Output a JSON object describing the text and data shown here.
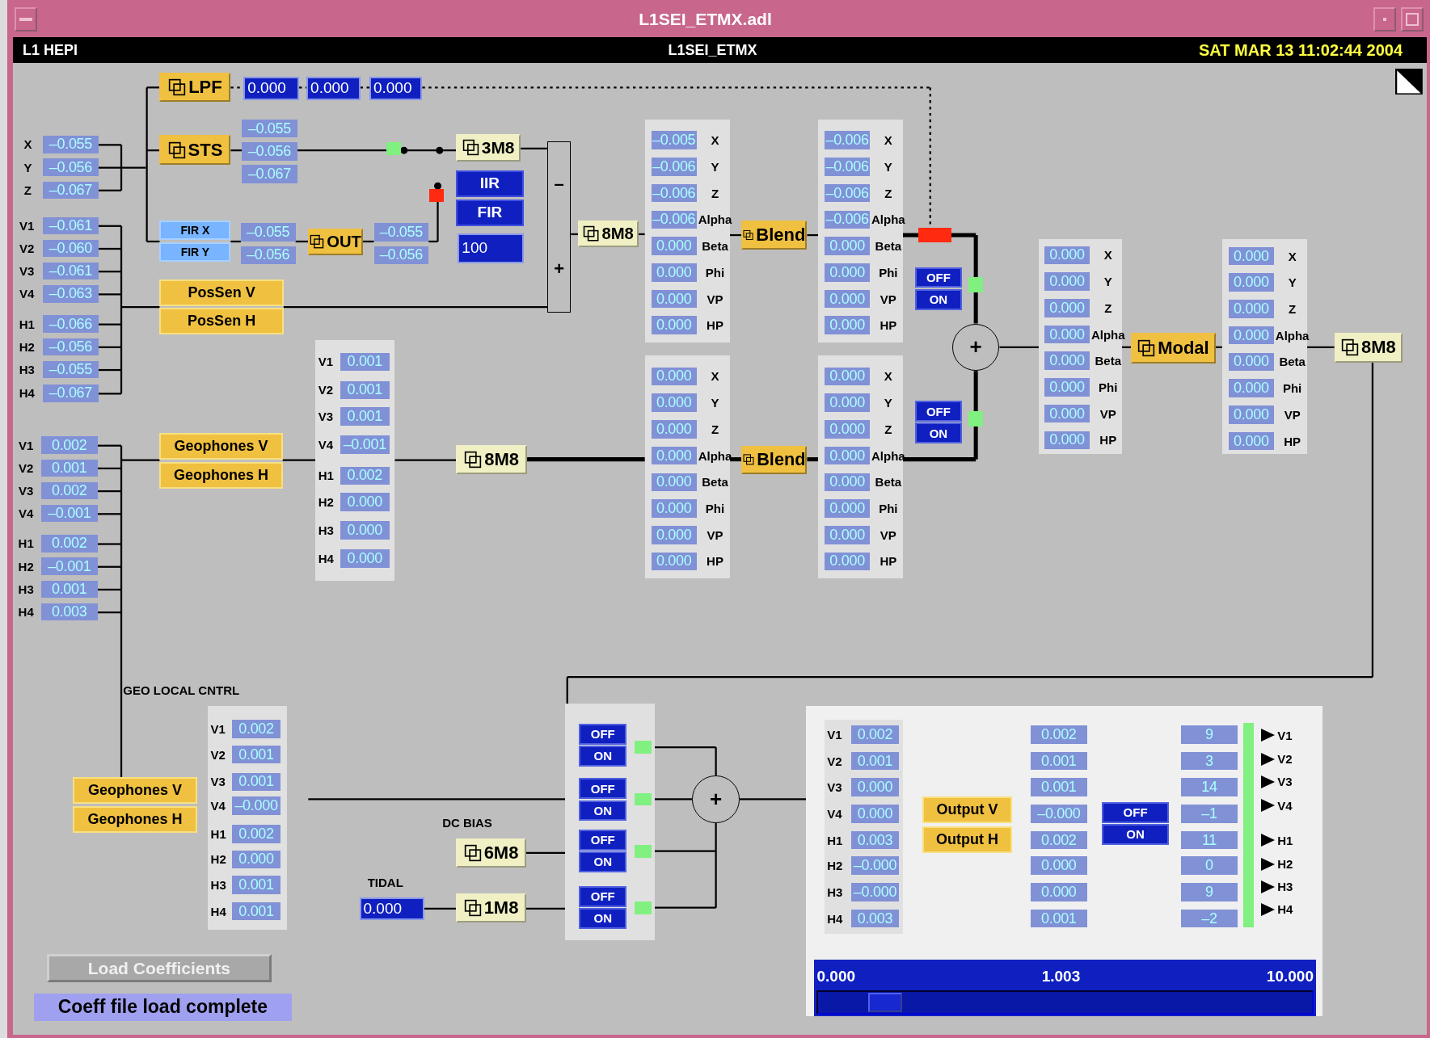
{
  "window": {
    "title": "L1SEI_ETMX.adl"
  },
  "header": {
    "system": "L1 HEPI",
    "screen": "L1SEI_ETMX",
    "timestamp": "SAT MAR 13 11:02:44 2004"
  },
  "columns": [
    {
      "rows": [
        {
          "label": "X",
          "value": "–0.055"
        },
        {
          "label": "Y",
          "value": "–0.056"
        },
        {
          "label": "Z",
          "value": "–0.067"
        }
      ]
    },
    {
      "rows": [
        {
          "label": "V1",
          "value": "–0.061"
        },
        {
          "label": "V2",
          "value": "–0.060"
        },
        {
          "label": "V3",
          "value": "–0.061"
        },
        {
          "label": "V4",
          "value": "–0.063"
        },
        {
          "label": "H1",
          "value": "–0.066"
        },
        {
          "label": "H2",
          "value": "–0.056"
        },
        {
          "label": "H3",
          "value": "–0.055"
        },
        {
          "label": "H4",
          "value": "–0.067"
        }
      ]
    },
    {
      "rows": [
        {
          "label": "V1",
          "value": "0.002"
        },
        {
          "label": "V2",
          "value": "0.001"
        },
        {
          "label": "V3",
          "value": "0.002"
        },
        {
          "label": "V4",
          "value": "–0.001"
        },
        {
          "label": "H1",
          "value": "0.002"
        },
        {
          "label": "H2",
          "value": "–0.001"
        },
        {
          "label": "H3",
          "value": "0.001"
        },
        {
          "label": "H4",
          "value": "0.003"
        }
      ]
    },
    {
      "rows": [
        {
          "value": "–0.055"
        },
        {
          "value": "–0.056"
        },
        {
          "value": "–0.067"
        }
      ]
    },
    {
      "rows": [
        {
          "value": "–0.055"
        },
        {
          "value": "–0.056"
        }
      ]
    },
    {
      "rows": [
        {
          "value": "–0.055"
        },
        {
          "value": "–0.056"
        }
      ]
    },
    {
      "rows": [
        {
          "label": "V1",
          "value": "0.001"
        },
        {
          "label": "V2",
          "value": "0.001"
        },
        {
          "label": "V3",
          "value": "0.001"
        },
        {
          "label": "V4",
          "value": "–0.001"
        },
        {
          "label": "H1",
          "value": "0.002"
        },
        {
          "label": "H2",
          "value": "0.000"
        },
        {
          "label": "H3",
          "value": "0.000"
        },
        {
          "label": "H4",
          "value": "0.000"
        }
      ]
    },
    {
      "rows": [
        {
          "label": "X",
          "value": "–0.005"
        },
        {
          "label": "Y",
          "value": "–0.006"
        },
        {
          "label": "Z",
          "value": "–0.006"
        },
        {
          "label": "Alpha",
          "value": "–0.006"
        },
        {
          "label": "Beta",
          "value": "0.000"
        },
        {
          "label": "Phi",
          "value": "0.000"
        },
        {
          "label": "VP",
          "value": "0.000"
        },
        {
          "label": "HP",
          "value": "0.000"
        }
      ]
    },
    {
      "rows": [
        {
          "label": "X",
          "value": "–0.006"
        },
        {
          "label": "Y",
          "value": "–0.006"
        },
        {
          "label": "Z",
          "value": "–0.006"
        },
        {
          "label": "Alpha",
          "value": "–0.006"
        },
        {
          "label": "Beta",
          "value": "0.000"
        },
        {
          "label": "Phi",
          "value": "0.000"
        },
        {
          "label": "VP",
          "value": "0.000"
        },
        {
          "label": "HP",
          "value": "0.000"
        }
      ]
    },
    {
      "rows": [
        {
          "label": "X",
          "value": "0.000"
        },
        {
          "label": "Y",
          "value": "0.000"
        },
        {
          "label": "Z",
          "value": "0.000"
        },
        {
          "label": "Alpha",
          "value": "0.000"
        },
        {
          "label": "Beta",
          "value": "0.000"
        },
        {
          "label": "Phi",
          "value": "0.000"
        },
        {
          "label": "VP",
          "value": "0.000"
        },
        {
          "label": "HP",
          "value": "0.000"
        }
      ]
    },
    {
      "rows": [
        {
          "label": "X",
          "value": "0.000"
        },
        {
          "label": "Y",
          "value": "0.000"
        },
        {
          "label": "Z",
          "value": "0.000"
        },
        {
          "label": "Alpha",
          "value": "0.000"
        },
        {
          "label": "Beta",
          "value": "0.000"
        },
        {
          "label": "Phi",
          "value": "0.000"
        },
        {
          "label": "VP",
          "value": "0.000"
        },
        {
          "label": "HP",
          "value": "0.000"
        }
      ]
    },
    {
      "rows": [
        {
          "label": "X",
          "value": "0.000"
        },
        {
          "label": "Y",
          "value": "0.000"
        },
        {
          "label": "Z",
          "value": "0.000"
        },
        {
          "label": "Alpha",
          "value": "0.000"
        },
        {
          "label": "Beta",
          "value": "0.000"
        },
        {
          "label": "Phi",
          "value": "0.000"
        },
        {
          "label": "VP",
          "value": "0.000"
        },
        {
          "label": "HP",
          "value": "0.000"
        }
      ]
    },
    {
      "rows": [
        {
          "label": "X",
          "value": "0.000"
        },
        {
          "label": "Y",
          "value": "0.000"
        },
        {
          "label": "Z",
          "value": "0.000"
        },
        {
          "label": "Alpha",
          "value": "0.000"
        },
        {
          "label": "Beta",
          "value": "0.000"
        },
        {
          "label": "Phi",
          "value": "0.000"
        },
        {
          "label": "VP",
          "value": "0.000"
        },
        {
          "label": "HP",
          "value": "0.000"
        }
      ]
    },
    {
      "rows": [
        {
          "label": "V1",
          "value": "0.002"
        },
        {
          "label": "V2",
          "value": "0.001"
        },
        {
          "label": "V3",
          "value": "0.001"
        },
        {
          "label": "V4",
          "value": "–0.000"
        },
        {
          "label": "H1",
          "value": "0.002"
        },
        {
          "label": "H2",
          "value": "0.000"
        },
        {
          "label": "H3",
          "value": "0.001"
        },
        {
          "label": "H4",
          "value": "0.001"
        }
      ]
    },
    {
      "rows": [
        {
          "label": "V1",
          "value": "0.002"
        },
        {
          "label": "V2",
          "value": "0.001"
        },
        {
          "label": "V3",
          "value": "0.000"
        },
        {
          "label": "V4",
          "value": "0.000"
        },
        {
          "label": "H1",
          "value": "0.003"
        },
        {
          "label": "H2",
          "value": "–0.000"
        },
        {
          "label": "H3",
          "value": "–0.000"
        },
        {
          "label": "H4",
          "value": "0.003"
        }
      ]
    },
    {
      "rows": [
        {
          "value": "0.002"
        },
        {
          "value": "0.001"
        },
        {
          "value": "0.001"
        },
        {
          "value": "–0.000"
        },
        {
          "value": "0.002"
        },
        {
          "value": "0.000"
        },
        {
          "value": "0.000"
        },
        {
          "value": "0.001"
        }
      ]
    },
    {
      "rows": [
        {
          "value": "9"
        },
        {
          "value": "3"
        },
        {
          "value": "14"
        },
        {
          "value": "–1"
        },
        {
          "value": "11"
        },
        {
          "value": "0"
        },
        {
          "value": "9"
        },
        {
          "value": "–2"
        }
      ]
    }
  ],
  "output_channels": [
    "V1",
    "V2",
    "V3",
    "V4",
    "H1",
    "H2",
    "H3",
    "H4"
  ],
  "related_buttons": [
    {
      "kind": "filter",
      "label": "LPF"
    },
    {
      "kind": "filter",
      "label": "STS"
    },
    {
      "kind": "filter",
      "label": "OUT"
    },
    {
      "kind": "matrix",
      "label": "3M8"
    },
    {
      "kind": "matrix",
      "label": "8M8"
    },
    {
      "kind": "filter",
      "label": "Blend"
    },
    {
      "kind": "filter",
      "label": "Blend"
    },
    {
      "kind": "matrix",
      "label": "8M8"
    },
    {
      "kind": "filter",
      "label": "Modal"
    },
    {
      "kind": "matrix",
      "label": "8M8"
    },
    {
      "kind": "matrix",
      "label": "6M8"
    },
    {
      "kind": "matrix",
      "label": "1M8"
    }
  ],
  "buttons": [
    {
      "kind": "fir",
      "label": "FIR X"
    },
    {
      "kind": "fir",
      "label": "FIR Y"
    },
    {
      "kind": "select",
      "label": "IIR"
    },
    {
      "kind": "select",
      "label": "FIR"
    },
    {
      "kind": "sensor",
      "label": "PosSen V"
    },
    {
      "kind": "sensor",
      "label": "PosSen H"
    },
    {
      "kind": "sensor",
      "label": "Geophones V"
    },
    {
      "kind": "sensor",
      "label": "Geophones H"
    },
    {
      "kind": "sensor",
      "label": "Geophones V"
    },
    {
      "kind": "sensor",
      "label": "Geophones H"
    },
    {
      "kind": "sensor",
      "label": "Output V"
    },
    {
      "kind": "sensor",
      "label": "Output H"
    }
  ],
  "fields": [
    "0.000",
    "0.000",
    "0.000",
    "100",
    "0.000"
  ],
  "toggles": [
    {
      "off": "OFF",
      "on": "ON"
    },
    {
      "off": "OFF",
      "on": "ON"
    },
    {
      "off": "OFF",
      "on": "ON"
    },
    {
      "off": "OFF",
      "on": "ON"
    },
    {
      "off": "OFF",
      "on": "ON"
    },
    {
      "off": "OFF",
      "on": "ON"
    },
    {
      "off": "OFF",
      "on": "ON"
    }
  ],
  "indicators": [
    {
      "color": "#80f080"
    },
    {
      "color": "#ff2a10"
    },
    {
      "color": "#ff2a10"
    },
    {
      "color": "#80f080"
    },
    {
      "color": "#80f080"
    },
    {
      "color": "#80f080"
    },
    {
      "color": "#80f080"
    },
    {
      "color": "#80f080"
    },
    {
      "color": "#80f080"
    },
    {
      "color": "#80f080"
    }
  ],
  "labels": [
    "GEO LOCAL CNTRL",
    "DC BIAS",
    "TIDAL"
  ],
  "sum_box": {
    "signs": [
      "–",
      "+"
    ]
  },
  "summers": [
    "+",
    "+"
  ],
  "slider": {
    "min": "0.000",
    "value": "1.003",
    "max": "10.000",
    "level": 0.1
  },
  "load_button": {
    "label": "Load Coefficients",
    "disabled": true
  },
  "message": "Coeff file load complete"
}
